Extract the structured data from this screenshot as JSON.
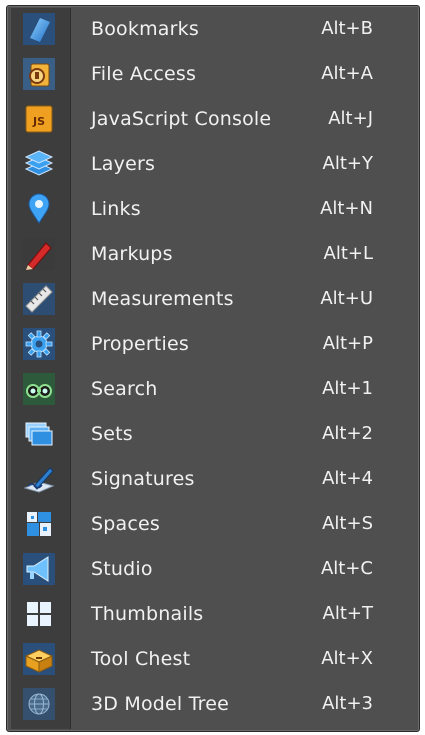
{
  "menu": {
    "items": [
      {
        "label": "Bookmarks",
        "shortcut": "Alt+B",
        "icon": "bookmark-icon"
      },
      {
        "label": "File Access",
        "shortcut": "Alt+A",
        "icon": "file-access-icon"
      },
      {
        "label": "JavaScript Console",
        "shortcut": "Alt+J",
        "icon": "javascript-icon"
      },
      {
        "label": "Layers",
        "shortcut": "Alt+Y",
        "icon": "layers-icon"
      },
      {
        "label": "Links",
        "shortcut": "Alt+N",
        "icon": "links-pin-icon"
      },
      {
        "label": "Markups",
        "shortcut": "Alt+L",
        "icon": "markup-pen-icon"
      },
      {
        "label": "Measurements",
        "shortcut": "Alt+U",
        "icon": "ruler-icon"
      },
      {
        "label": "Properties",
        "shortcut": "Alt+P",
        "icon": "gear-icon"
      },
      {
        "label": "Search",
        "shortcut": "Alt+1",
        "icon": "binoculars-icon"
      },
      {
        "label": "Sets",
        "shortcut": "Alt+2",
        "icon": "sets-stack-icon"
      },
      {
        "label": "Signatures",
        "shortcut": "Alt+4",
        "icon": "signature-pen-icon"
      },
      {
        "label": "Spaces",
        "shortcut": "Alt+S",
        "icon": "floorplan-icon"
      },
      {
        "label": "Studio",
        "shortcut": "Alt+C",
        "icon": "studio-megaphone-icon"
      },
      {
        "label": "Thumbnails",
        "shortcut": "Alt+T",
        "icon": "thumbnails-grid-icon"
      },
      {
        "label": "Tool Chest",
        "shortcut": "Alt+X",
        "icon": "tool-chest-icon"
      },
      {
        "label": "3D Model Tree",
        "shortcut": "Alt+3",
        "icon": "globe-icon"
      }
    ]
  },
  "colors": {
    "background": "#4f4f4f",
    "icon_strip": "#3d3d3d",
    "text": "#f1f1f1",
    "accent_blue": "#2f8fe0",
    "accent_orange": "#f0a020",
    "accent_red": "#d42a2a"
  }
}
